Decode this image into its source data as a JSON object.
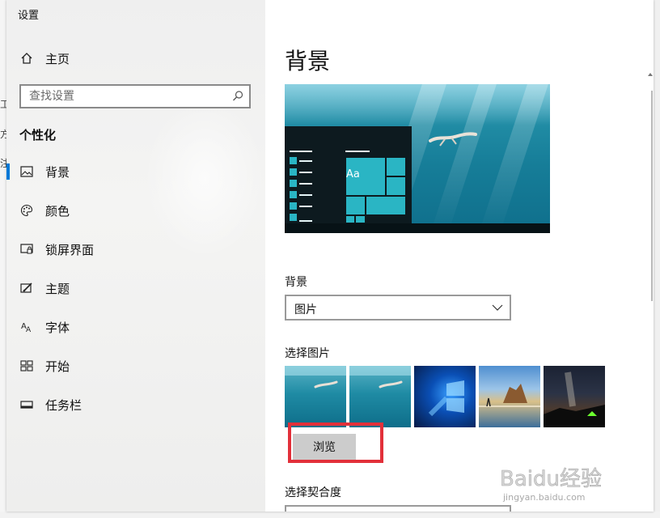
{
  "window": {
    "title": "设置"
  },
  "sidebar": {
    "home_label": "主页",
    "search_placeholder": "查找设置",
    "section_title": "个性化",
    "items": [
      {
        "label": "背景",
        "icon": "picture-icon"
      },
      {
        "label": "颜色",
        "icon": "palette-icon"
      },
      {
        "label": "锁屏界面",
        "icon": "lock-screen-icon"
      },
      {
        "label": "主题",
        "icon": "theme-icon"
      },
      {
        "label": "字体",
        "icon": "font-icon"
      },
      {
        "label": "开始",
        "icon": "start-icon"
      },
      {
        "label": "任务栏",
        "icon": "taskbar-icon"
      }
    ]
  },
  "content": {
    "page_title": "背景",
    "preview": {
      "tile_text": "Aa"
    },
    "background_label": "背景",
    "background_value": "图片",
    "choose_picture_label": "选择图片",
    "browse_label": "浏览",
    "choose_fit_label": "选择契合度"
  },
  "background_window_chars": [
    "工",
    "方",
    "注"
  ],
  "watermark": {
    "brand": "Baidu经验",
    "url": "jingyan.baidu.com"
  },
  "colors": {
    "accent": "#2ab5c4",
    "highlight": "#e2303a",
    "nav_indicator": "#0078d7"
  }
}
